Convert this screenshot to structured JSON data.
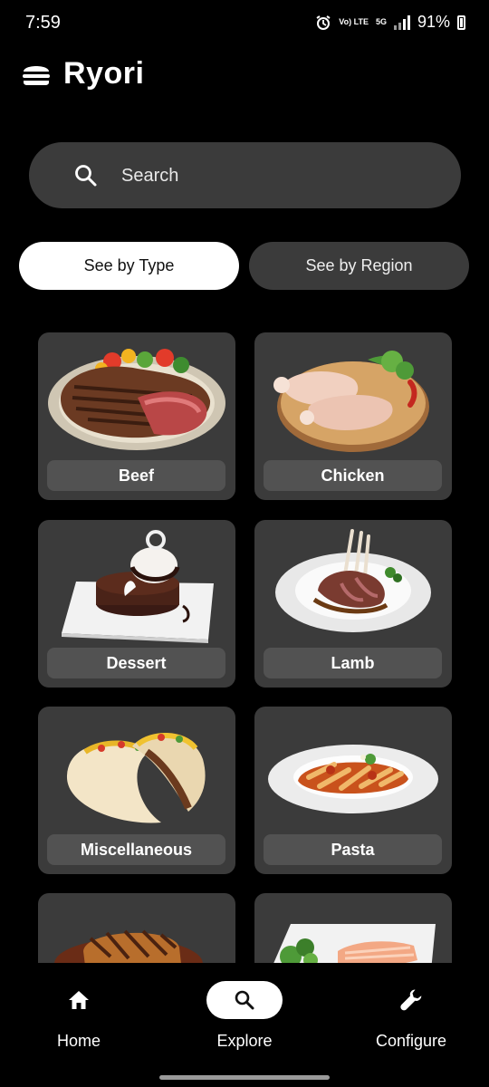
{
  "status": {
    "time": "7:59",
    "volte": "Vo) LTE",
    "network": "5G",
    "battery": "91%"
  },
  "app": {
    "title": "Ryori",
    "logo_icon": "burger-icon"
  },
  "search": {
    "placeholder": "Search",
    "icon": "search-icon"
  },
  "segments": [
    {
      "label": "See by Type",
      "selected": true
    },
    {
      "label": "See by Region",
      "selected": false
    }
  ],
  "categories": [
    {
      "label": "Beef"
    },
    {
      "label": "Chicken"
    },
    {
      "label": "Dessert"
    },
    {
      "label": "Lamb"
    },
    {
      "label": "Miscellaneous"
    },
    {
      "label": "Pasta"
    },
    {
      "label": ""
    },
    {
      "label": ""
    }
  ],
  "nav": [
    {
      "label": "Home",
      "icon": "home-icon",
      "active": false
    },
    {
      "label": "Explore",
      "icon": "search-icon",
      "active": true
    },
    {
      "label": "Configure",
      "icon": "wrench-icon",
      "active": false
    }
  ],
  "colors": {
    "background": "#000000",
    "surface": "#3b3b3b",
    "label_chip": "#525252",
    "active_pill": "#ffffff"
  }
}
